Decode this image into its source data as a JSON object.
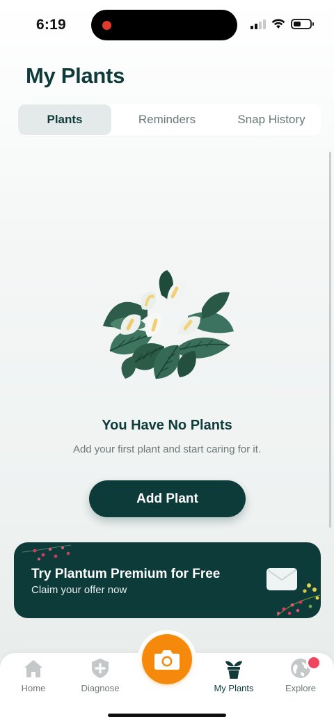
{
  "status_bar": {
    "time": "6:19"
  },
  "header": {
    "title": "My Plants"
  },
  "tabs": [
    {
      "label": "Plants",
      "active": true
    },
    {
      "label": "Reminders",
      "active": false
    },
    {
      "label": "Snap History",
      "active": false
    }
  ],
  "empty_state": {
    "title": "You Have No Plants",
    "subtitle": "Add your first plant and start caring for it.",
    "button_label": "Add Plant",
    "illustration": "peace-lily-illustration"
  },
  "promo": {
    "title": "Try Plantum Premium for Free",
    "subtitle": "Claim your offer now",
    "icon": "envelope-icon"
  },
  "bottom_nav": {
    "items": [
      {
        "label": "Home",
        "icon": "home-icon",
        "active": false
      },
      {
        "label": "Diagnose",
        "icon": "shield-plus-icon",
        "active": false
      },
      {
        "label": "My Plants",
        "icon": "potted-plant-icon",
        "active": true
      },
      {
        "label": "Explore",
        "icon": "globe-icon",
        "active": false
      }
    ],
    "camera_icon": "camera-icon"
  },
  "colors": {
    "primary": "#0d3b3a",
    "accent": "#f5890c",
    "notification": "#f0455f",
    "background": "#eef2f1"
  }
}
